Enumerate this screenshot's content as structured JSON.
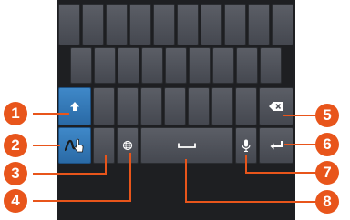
{
  "callouts": [
    {
      "id": 1,
      "label": "1",
      "target": "shift-key"
    },
    {
      "id": 2,
      "label": "2",
      "target": "handwriting-key"
    },
    {
      "id": 3,
      "label": "3",
      "target": "number-symbol-key"
    },
    {
      "id": 4,
      "label": "4",
      "target": "language-key"
    },
    {
      "id": 5,
      "label": "5",
      "target": "backspace-key"
    },
    {
      "id": 6,
      "label": "6",
      "target": "enter-key"
    },
    {
      "id": 7,
      "label": "7",
      "target": "voice-input-key"
    },
    {
      "id": 8,
      "label": "8",
      "target": "space-key"
    }
  ],
  "colors": {
    "callout": "#e8551b",
    "accent_key": "#2a6aa6",
    "key": "#4f525a",
    "keyboard_bg": "#1e1f22"
  },
  "icons": [
    "shift-icon",
    "handwriting-icon",
    "globe-icon",
    "space-icon",
    "microphone-icon",
    "backspace-icon",
    "enter-icon"
  ]
}
